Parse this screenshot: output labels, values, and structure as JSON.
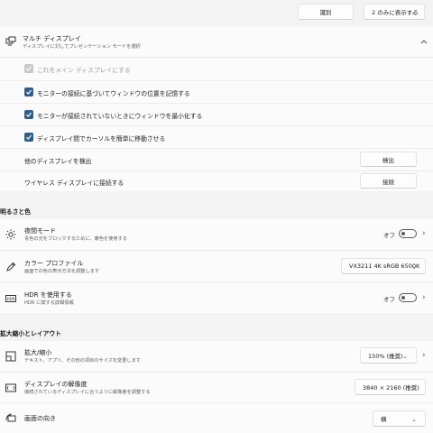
{
  "top": {
    "identify_button": "識別",
    "display_mode_select": "2 のみに表示する"
  },
  "multi_display": {
    "title": "マルチ ディスプレイ",
    "subtitle": "ディスプレイに対してプレゼンテーション モードを選択",
    "checkboxes": [
      {
        "label": "これをメイン ディスプレイにする",
        "checked": true,
        "disabled": true
      },
      {
        "label": "モニターの接続に基づいてウィンドウの位置を記憶する",
        "checked": true,
        "disabled": false
      },
      {
        "label": "モニターが接続されていないときにウィンドウを最小化する",
        "checked": true,
        "disabled": false
      },
      {
        "label": "ディスプレイ間でカーソルを簡単に移動させる",
        "checked": true,
        "disabled": false
      }
    ],
    "detect_label": "他のディスプレイを検出",
    "detect_button": "検出",
    "wireless_label": "ワイヤレス ディスプレイに接続する",
    "wireless_button": "接続"
  },
  "brightness_section": {
    "heading": "明るさと色",
    "night_light": {
      "title": "夜間モード",
      "subtitle": "青色の光をブロックするために、暖色を使用する",
      "state": "オフ"
    },
    "color_profile": {
      "title": "カラー プロファイル",
      "subtitle": "画面での色の表示方法を調整します",
      "value": "VX3211 4K sRGB 6500K"
    },
    "hdr": {
      "title": "HDR を使用する",
      "subtitle": "HDR に関する詳細情報",
      "state": "オフ"
    }
  },
  "scale_section": {
    "heading": "拡大縮小とレイアウト",
    "scale": {
      "title": "拡大/縮小",
      "subtitle": "テキスト、アプリ、その他の項目のサイズを変更します",
      "value": "150% (推奨)"
    },
    "resolution": {
      "title": "ディスプレイの解像度",
      "subtitle": "接続されているディスプレイに合うように解像度を調整する",
      "value": "3840 × 2160 (推奨)"
    },
    "orientation": {
      "title": "画面の向き",
      "value": "横"
    }
  }
}
